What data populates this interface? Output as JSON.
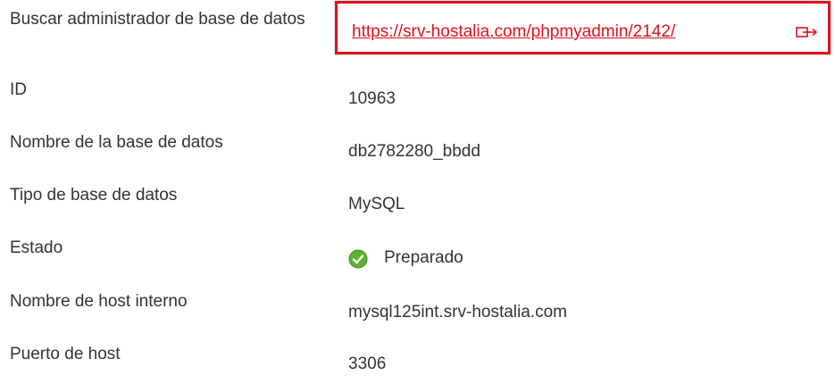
{
  "rows": [
    {
      "label": "Buscar administrador de base de datos",
      "value": "https://srv-hostalia.com/phpmyadmin/2142/"
    },
    {
      "label": "ID",
      "value": "10963"
    },
    {
      "label": "Nombre de la base de datos",
      "value": "db2782280_bbdd"
    },
    {
      "label": "Tipo de base de datos",
      "value": "MySQL"
    },
    {
      "label": "Estado",
      "value": "Preparado",
      "icon": "check-circle-icon"
    },
    {
      "label": "Nombre de host interno",
      "value": "mysql125int.srv-hostalia.com"
    },
    {
      "label": "Puerto de host",
      "value": "3306"
    }
  ],
  "colors": {
    "text": "#333333",
    "link": "#e0111b",
    "highlight_border": "#e0111b",
    "status_green": "#5cb330"
  },
  "link_icon": "external-link-icon"
}
